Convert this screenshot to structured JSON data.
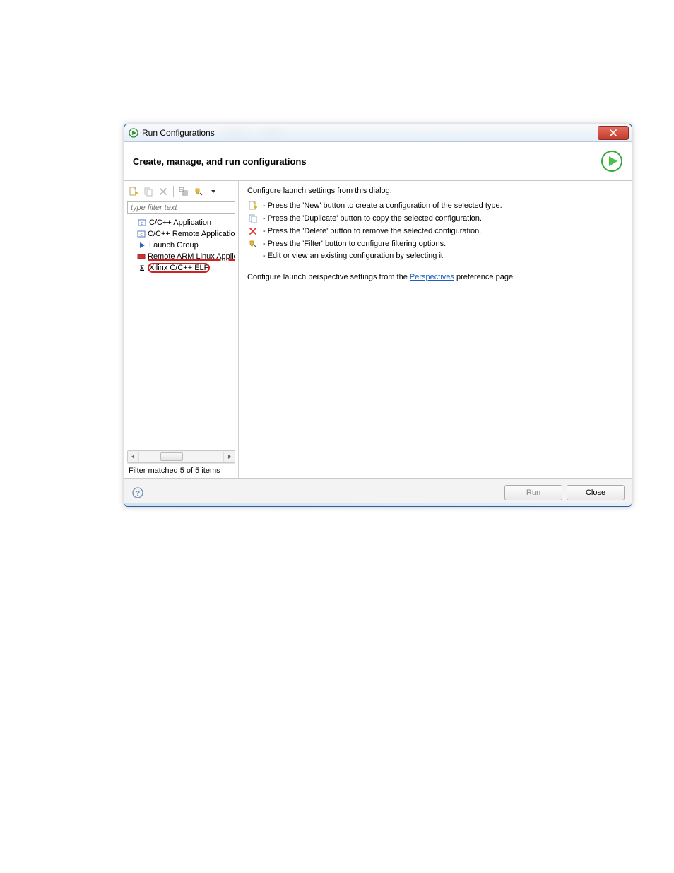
{
  "window": {
    "title": "Run Configurations"
  },
  "header": {
    "title": "Create, manage, and run configurations"
  },
  "left": {
    "filter_placeholder": "type filter text",
    "items": [
      {
        "label": "C/C++ Application"
      },
      {
        "label": "C/C++ Remote Application"
      },
      {
        "label": "Launch Group"
      },
      {
        "label": "Remote ARM Linux Applicati"
      },
      {
        "label": "Xilinx C/C++ ELF"
      }
    ],
    "filter_status": "Filter matched 5 of 5 items"
  },
  "right": {
    "intro": "Configure launch settings from this dialog:",
    "lines": [
      "- Press the 'New' button to create a configuration of the selected type.",
      "- Press the 'Duplicate' button to copy the selected configuration.",
      "- Press the 'Delete' button to remove the selected configuration.",
      "- Press the 'Filter' button to configure filtering options.",
      "- Edit or view an existing configuration by selecting it."
    ],
    "persp_prefix": "Configure launch perspective settings from the ",
    "persp_link": "Perspectives",
    "persp_suffix": " preference page."
  },
  "footer": {
    "run": "Run",
    "close": "Close"
  }
}
